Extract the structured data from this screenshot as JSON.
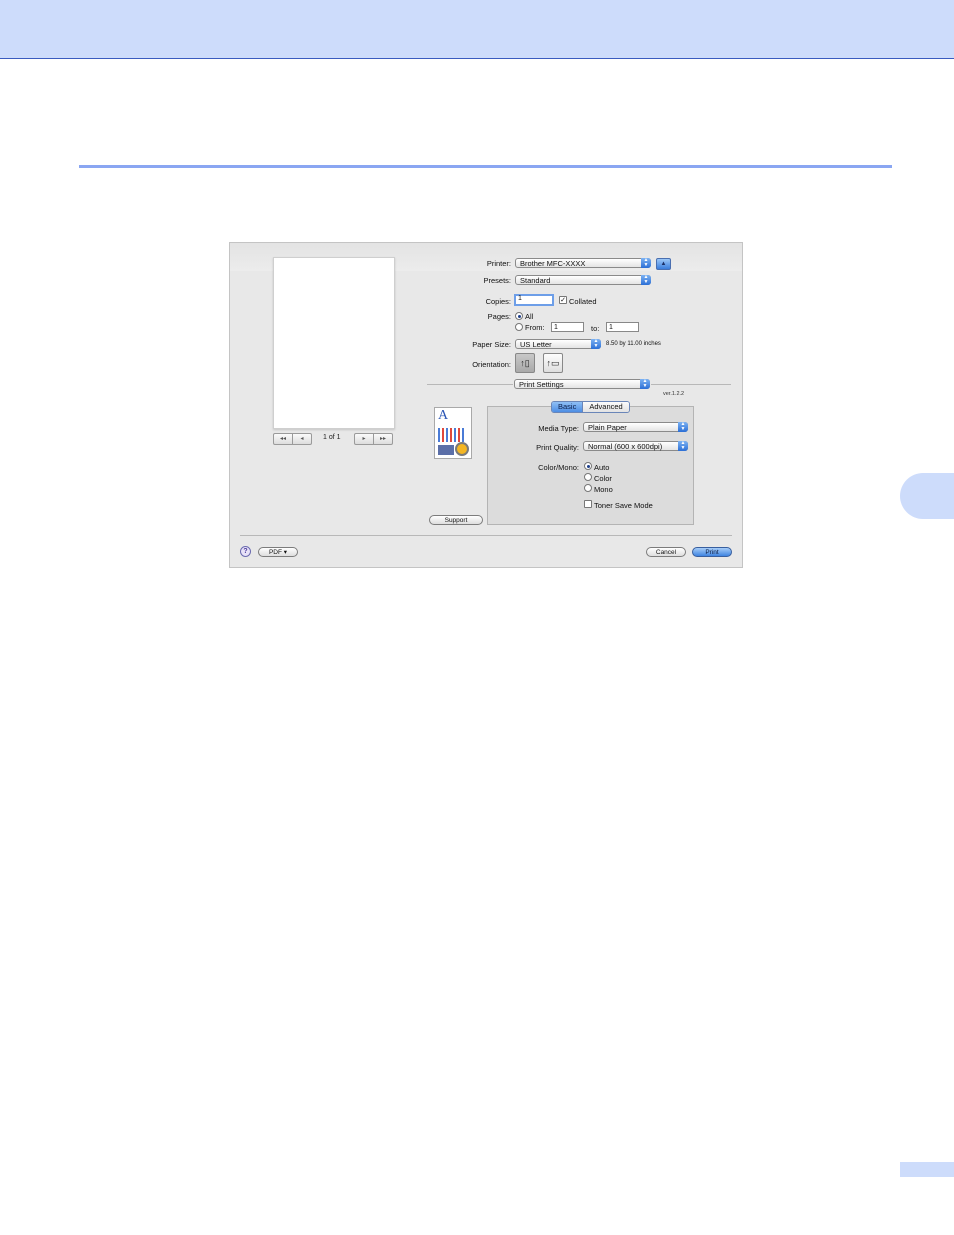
{
  "dialog": {
    "printer": {
      "label": "Printer:",
      "value": "Brother MFC-XXXX"
    },
    "presets": {
      "label": "Presets:",
      "value": "Standard"
    },
    "copies": {
      "label": "Copies:",
      "value": "1",
      "collated_label": "Collated",
      "collated_checked": true
    },
    "pages": {
      "label": "Pages:",
      "all_label": "All",
      "from_label": "From:",
      "from_value": "1",
      "to_label": "to:",
      "to_value": "1",
      "selected": "All"
    },
    "paper_size": {
      "label": "Paper Size:",
      "value": "US Letter",
      "dimensions": "8.50 by 11.00 inches"
    },
    "orientation": {
      "label": "Orientation:",
      "selected": "portrait"
    },
    "preview": {
      "page_count": "1 of 1",
      "first": "◂◂",
      "prev": "◂",
      "next": "▸",
      "last": "▸▸"
    },
    "panel_select": {
      "value": "Print Settings"
    },
    "version": "ver.1.2.2",
    "tabs": {
      "basic": "Basic",
      "advanced": "Advanced",
      "active": "Basic"
    },
    "media_type": {
      "label": "Media Type:",
      "value": "Plain Paper"
    },
    "print_quality": {
      "label": "Print Quality:",
      "value": "Normal (600 x 600dpi)"
    },
    "color_mono": {
      "label": "Color/Mono:",
      "options": [
        "Auto",
        "Color",
        "Mono"
      ],
      "selected": "Auto"
    },
    "toner_save": {
      "label": "Toner Save Mode",
      "checked": false
    },
    "support_label": "Support",
    "pdf_label": "PDF ▾",
    "cancel_label": "Cancel",
    "print_label": "Print",
    "help_glyph": "?"
  },
  "colors": {
    "header_band": "#cddcfb",
    "section_rule": "#8aa6f2",
    "accent_blue": "#4d8ee4"
  }
}
